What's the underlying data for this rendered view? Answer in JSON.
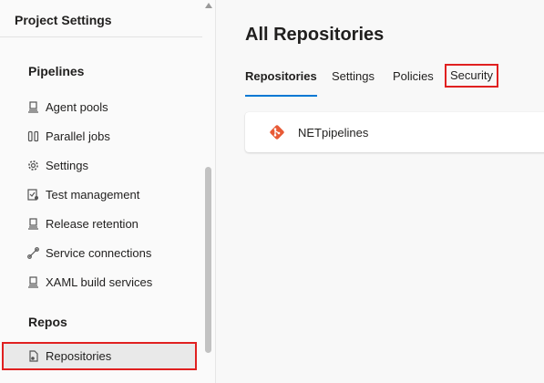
{
  "sidebar": {
    "title": "Project Settings",
    "sections": [
      {
        "heading": "Pipelines",
        "items": [
          {
            "label": "Agent pools",
            "icon": "agent-pool-icon"
          },
          {
            "label": "Parallel jobs",
            "icon": "parallel-jobs-icon"
          },
          {
            "label": "Settings",
            "icon": "gear-icon"
          },
          {
            "label": "Test management",
            "icon": "test-management-icon"
          },
          {
            "label": "Release retention",
            "icon": "release-retention-icon"
          },
          {
            "label": "Service connections",
            "icon": "service-connection-icon"
          },
          {
            "label": "XAML build services",
            "icon": "xaml-build-icon"
          }
        ]
      },
      {
        "heading": "Repos",
        "items": [
          {
            "label": "Repositories",
            "icon": "repository-icon",
            "selected": true
          }
        ]
      }
    ]
  },
  "main": {
    "title": "All Repositories",
    "tabs": [
      {
        "label": "Repositories",
        "active": true
      },
      {
        "label": "Settings"
      },
      {
        "label": "Policies"
      },
      {
        "label": "Security",
        "highlighted": true
      }
    ],
    "repositories": [
      {
        "name": "NETpipelines",
        "icon": "git-icon"
      }
    ]
  },
  "colors": {
    "accent": "#0078d4",
    "highlight_border": "#e02020",
    "git_brand": "#e85a36"
  }
}
